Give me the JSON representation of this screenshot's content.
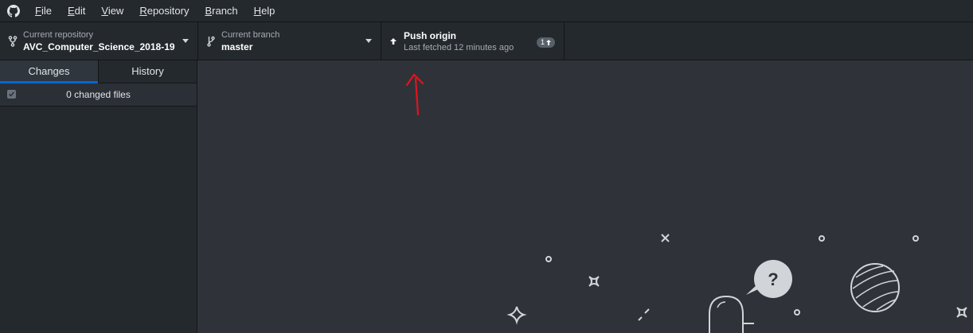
{
  "menu": {
    "items": [
      {
        "label": "File",
        "mnemonic": "F",
        "rest": "ile"
      },
      {
        "label": "Edit",
        "mnemonic": "E",
        "rest": "dit"
      },
      {
        "label": "View",
        "mnemonic": "V",
        "rest": "iew"
      },
      {
        "label": "Repository",
        "mnemonic": "R",
        "rest": "epository"
      },
      {
        "label": "Branch",
        "mnemonic": "B",
        "rest": "ranch"
      },
      {
        "label": "Help",
        "mnemonic": "H",
        "rest": "elp"
      }
    ]
  },
  "toolbar": {
    "repo": {
      "title": "Current repository",
      "value": "AVC_Computer_Science_2018-19",
      "icon": "repo-icon"
    },
    "branch": {
      "title": "Current branch",
      "value": "master",
      "icon": "branch-icon"
    },
    "push": {
      "title": "Push origin",
      "subtitle": "Last fetched 12 minutes ago",
      "badge_count": "1",
      "icon": "arrow-up-icon"
    }
  },
  "sidebar": {
    "tabs": [
      {
        "label": "Changes",
        "selected": true
      },
      {
        "label": "History",
        "selected": false
      }
    ],
    "changes_summary": "0 changed files"
  },
  "annotation": {
    "color": "#e0141e",
    "shape": "red-arrow"
  },
  "colors": {
    "accent": "#0366d6",
    "toolbar_bg": "#24292e",
    "main_bg": "#2f3339"
  }
}
